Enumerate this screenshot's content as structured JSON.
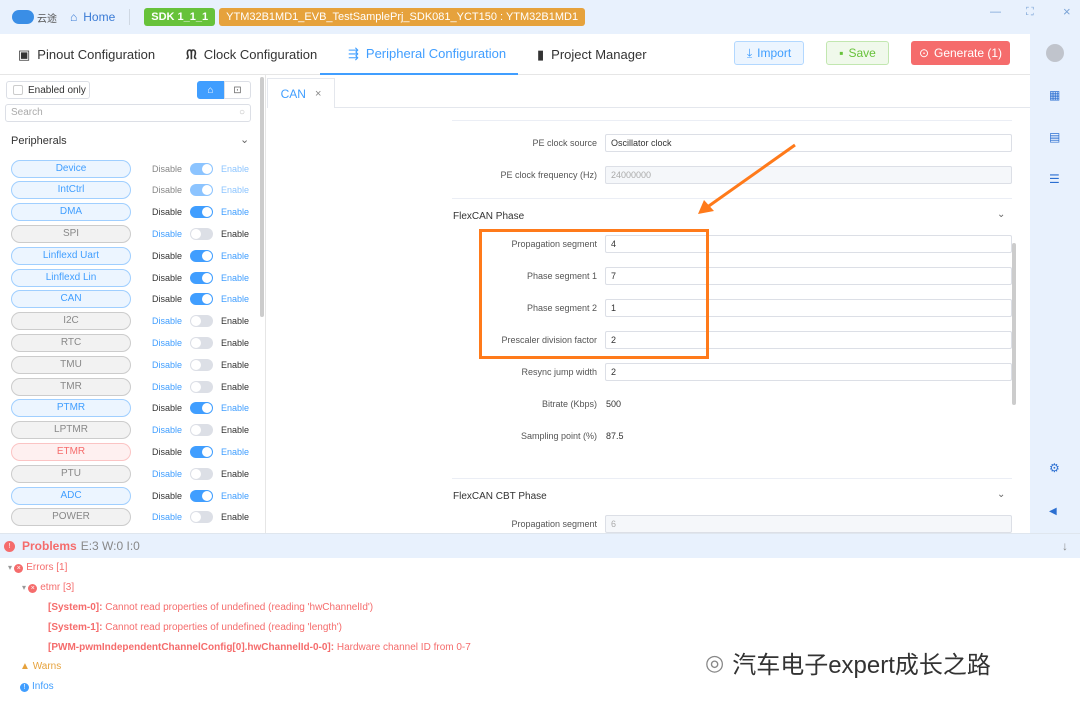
{
  "titlebar": {
    "logo_text": "云途",
    "home": "Home",
    "sdk": "SDK 1_1_1",
    "project": "YTM32B1MD1_EVB_TestSamplePrj_SDK081_YCT150 : YTM32B1MD1",
    "minimize": "—",
    "maximize": "⛶",
    "close": "×"
  },
  "tabs": [
    {
      "label": "Pinout Configuration",
      "icon": "chip-icon"
    },
    {
      "label": "Clock Configuration",
      "icon": "clock-wave-icon"
    },
    {
      "label": "Peripheral Configuration",
      "icon": "usb-icon",
      "active": true
    },
    {
      "label": "Project Manager",
      "icon": "book-icon"
    }
  ],
  "actions": {
    "import": "Import",
    "save": "Save",
    "generate": "Generate (1)"
  },
  "colors": {
    "accent": "#409eff",
    "save": "#67c23a",
    "generate": "#f56c6c",
    "highlight": "#ff7a1a"
  },
  "left": {
    "enabled_only": "Enabled only",
    "search_placeholder": "Search",
    "peripherals_title": "Peripherals",
    "disable": "Disable",
    "enable": "Enable",
    "items": [
      {
        "name": "Device",
        "enabled": true,
        "locked": true
      },
      {
        "name": "IntCtrl",
        "enabled": true,
        "locked": true
      },
      {
        "name": "DMA",
        "enabled": true
      },
      {
        "name": "SPI",
        "enabled": false
      },
      {
        "name": "Linflexd Uart",
        "enabled": true
      },
      {
        "name": "Linflexd Lin",
        "enabled": true
      },
      {
        "name": "CAN",
        "enabled": true
      },
      {
        "name": "I2C",
        "enabled": false
      },
      {
        "name": "RTC",
        "enabled": false
      },
      {
        "name": "TMU",
        "enabled": false
      },
      {
        "name": "TMR",
        "enabled": false
      },
      {
        "name": "PTMR",
        "enabled": true
      },
      {
        "name": "LPTMR",
        "enabled": false
      },
      {
        "name": "ETMR",
        "enabled": true,
        "error": true
      },
      {
        "name": "PTU",
        "enabled": false
      },
      {
        "name": "ADC",
        "enabled": true
      },
      {
        "name": "POWER",
        "enabled": false
      }
    ]
  },
  "content": {
    "tab": "CAN",
    "tab_close": "×",
    "clock": [
      {
        "label": "PE clock source",
        "value": "Oscillator clock",
        "type": "select"
      },
      {
        "label": "PE clock frequency (Hz)",
        "value": "24000000",
        "type": "readonly"
      }
    ],
    "flexcan_phase": {
      "title": "FlexCAN Phase",
      "fields": [
        {
          "label": "Propagation segment",
          "value": "4",
          "type": "input"
        },
        {
          "label": "Phase segment 1",
          "value": "7",
          "type": "input"
        },
        {
          "label": "Phase segment 2",
          "value": "1",
          "type": "input"
        },
        {
          "label": "Prescaler division factor",
          "value": "2",
          "type": "input"
        },
        {
          "label": "Resync jump width",
          "value": "2",
          "type": "input"
        },
        {
          "label": "Bitrate (Kbps)",
          "value": "500",
          "type": "text"
        },
        {
          "label": "Sampling point (%)",
          "value": "87.5",
          "type": "text"
        }
      ]
    },
    "cbt_phase": {
      "title": "FlexCAN CBT Phase",
      "fields": [
        {
          "label": "Propagation segment",
          "value": "6",
          "type": "readonly"
        }
      ]
    }
  },
  "problems": {
    "title": "Problems",
    "counts": "E:3 W:0 I:0",
    "errors": "Errors [1]",
    "etmr": "etmr [3]",
    "messages": [
      {
        "key": "[System-0]:",
        "text": " Cannot read properties of undefined (reading 'hwChannelId')"
      },
      {
        "key": "[System-1]:",
        "text": " Cannot read properties of undefined (reading 'length')"
      },
      {
        "key": "[PWM-pwmIndependentChannelConfig[0].hwChannelId-0-0]:",
        "text": " Hardware channel ID from 0-7"
      }
    ],
    "warns": "Warns",
    "infos": "Infos"
  },
  "watermark": "汽车电子expert成长之路"
}
